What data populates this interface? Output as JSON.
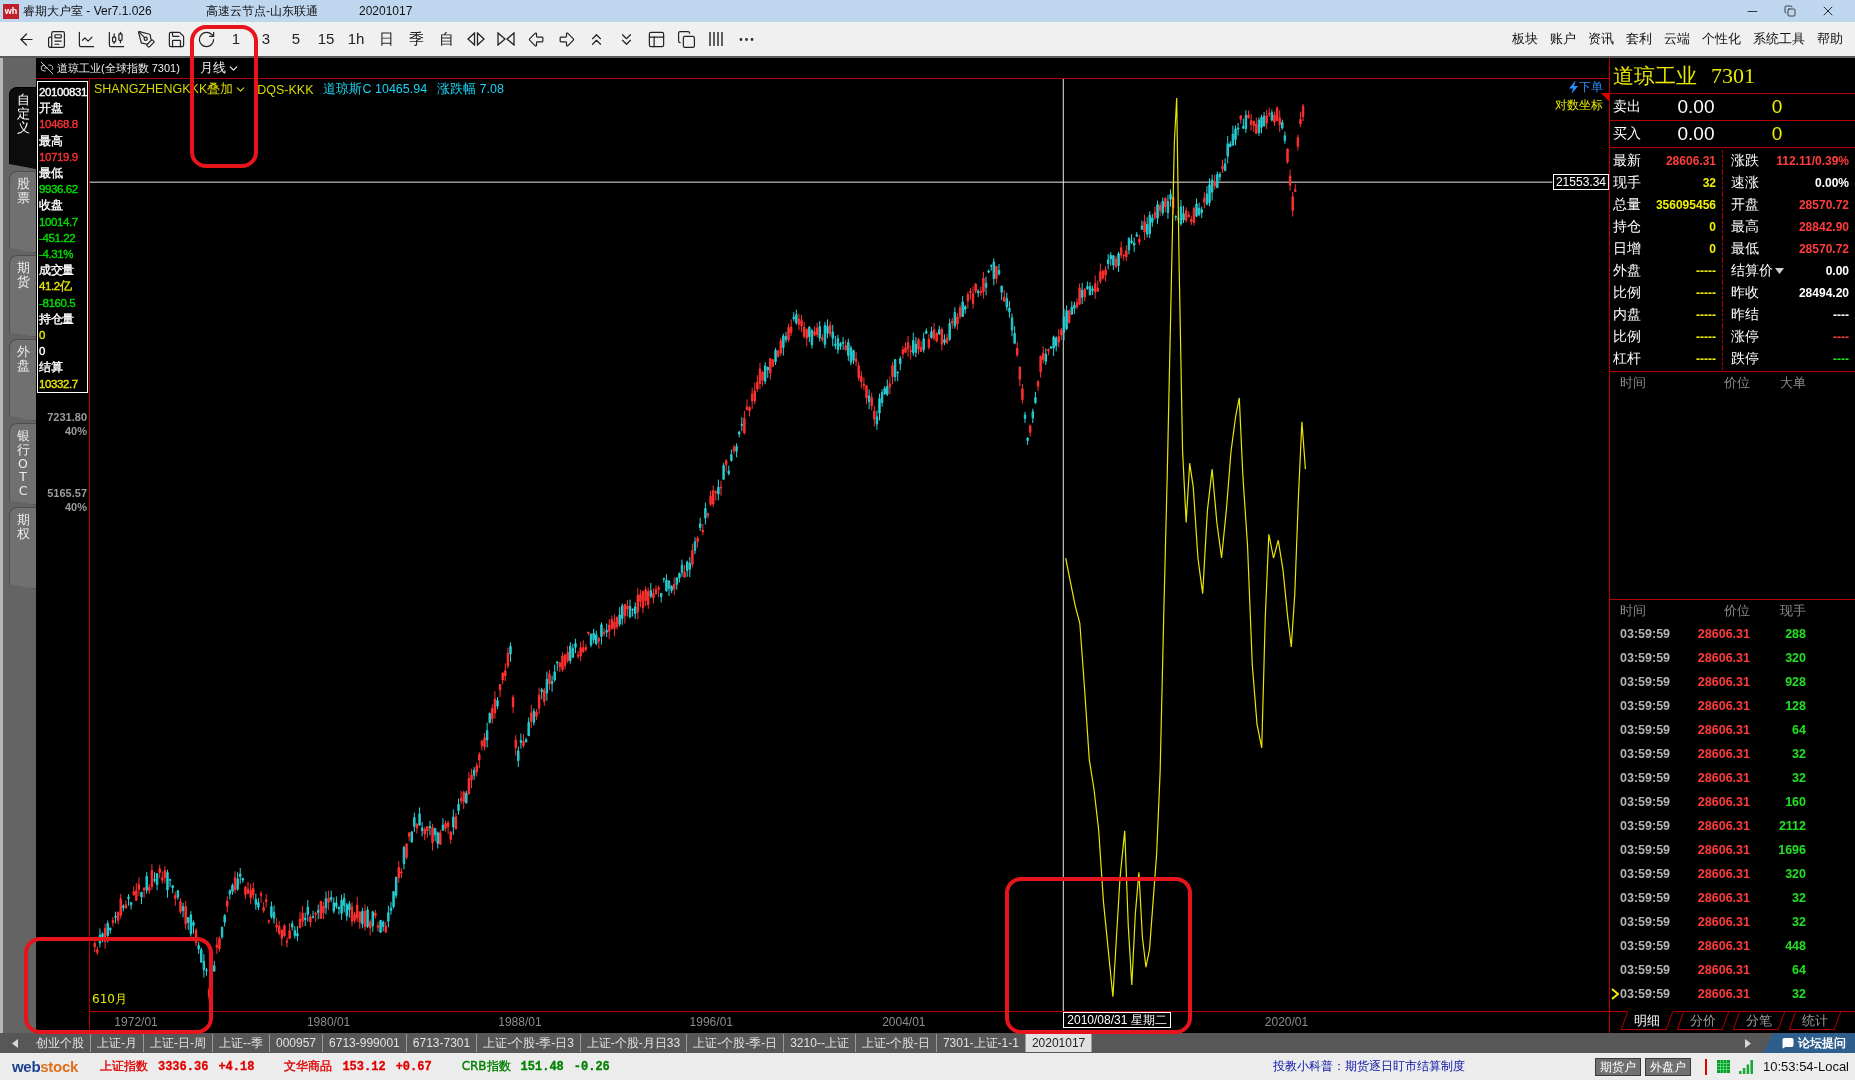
{
  "window": {
    "logo": "wh",
    "title": "睿期大户室 - Ver7.1.026",
    "server": "高速云节点-山东联通",
    "date": "20201017"
  },
  "toolbar": {
    "periods": [
      "1",
      "3",
      "5",
      "15",
      "1h",
      "日",
      "季",
      "自"
    ]
  },
  "menu": [
    "板块",
    "账户",
    "资讯",
    "套利",
    "云端",
    "个性化",
    "系统工具",
    "帮助"
  ],
  "side_tabs": [
    {
      "label": "自定义",
      "selected": true
    },
    {
      "label": "股票",
      "selected": false
    },
    {
      "label": "期货",
      "selected": false
    },
    {
      "label": "外盘",
      "selected": false
    },
    {
      "label": "银行OTC",
      "selected": false
    },
    {
      "label": "期权",
      "selected": false
    }
  ],
  "chart": {
    "title": "道琼工业(全球指数 7301)",
    "period": "月线",
    "overlay": "SHANGZHENGKKK叠加",
    "overlay_symbol": "DQS-KKK",
    "readouts": [
      "道琼斯C 10465.94",
      "涨跌幅 7.08"
    ],
    "order_link": "下单",
    "scale_mode": "对数坐标",
    "cursor_values": [
      {
        "text": "20100831",
        "color": "#ffffff"
      },
      {
        "text": "开盘",
        "color": "#ffffff"
      },
      {
        "text": "10468.8",
        "color": "#ff3232"
      },
      {
        "text": "最高",
        "color": "#ffffff"
      },
      {
        "text": "10719.9",
        "color": "#ff3232"
      },
      {
        "text": "最低",
        "color": "#ffffff"
      },
      {
        "text": "9936.62",
        "color": "#00e000"
      },
      {
        "text": "收盘",
        "color": "#ffffff"
      },
      {
        "text": "10014.7",
        "color": "#00e000"
      },
      {
        "text": "-451.22",
        "color": "#00e000"
      },
      {
        "text": "-4.31%",
        "color": "#00e000"
      },
      {
        "text": "成交量",
        "color": "#ffffff"
      },
      {
        "text": "41.2亿",
        "color": "#e8e800"
      },
      {
        "text": "-8160.5",
        "color": "#00e000"
      },
      {
        "text": "持仓量",
        "color": "#ffffff"
      },
      {
        "text": "0",
        "color": "#e8e800"
      },
      {
        "text": "0",
        "color": "#ffffff"
      },
      {
        "text": "结算",
        "color": "#ffffff"
      },
      {
        "text": "10332.7",
        "color": "#e8e800"
      }
    ],
    "axis_labels": [
      {
        "price": "7231.80",
        "percent": "40%"
      },
      {
        "price": "5165.57",
        "percent": "40%"
      }
    ],
    "period_marker": "610月",
    "x_labels": [
      "1972/01",
      "1980/01",
      "1988/01",
      "1996/01",
      "2004/01",
      "2020/01"
    ],
    "cursor_date": "2010/08/31 星期二",
    "cursor_price": "21553.34"
  },
  "quote_panel": {
    "name": "道琼工业",
    "code": "7301",
    "book": [
      {
        "label": "卖出",
        "price": "0.00",
        "volume": "0"
      },
      {
        "label": "买入",
        "price": "0.00",
        "volume": "0"
      }
    ],
    "rows": [
      {
        "left": {
          "kind": "field",
          "label": "最新",
          "value": "28606.31",
          "color": "#ff3c3c"
        },
        "right": {
          "kind": "field",
          "label": "涨跌",
          "value": "112.11/0.39%",
          "color": "#ff3c3c"
        }
      },
      {
        "left": {
          "kind": "field",
          "label": "现手",
          "value": "32",
          "color": "#f0f000"
        },
        "right": {
          "kind": "field",
          "label": "速涨",
          "value": "0.00%",
          "color": "#ffffff"
        }
      },
      {
        "left": {
          "kind": "field",
          "label": "总量",
          "value": "356095456",
          "color": "#f0f000"
        },
        "right": {
          "kind": "field",
          "label": "开盘",
          "value": "28570.72",
          "color": "#ff3c3c"
        }
      },
      {
        "left": {
          "kind": "field",
          "label": "持仓",
          "value": "0",
          "color": "#f0f000"
        },
        "right": {
          "kind": "field",
          "label": "最高",
          "value": "28842.90",
          "color": "#ff3c3c"
        }
      },
      {
        "left": {
          "kind": "field",
          "label": "日增",
          "value": "0",
          "color": "#f0f000"
        },
        "right": {
          "kind": "field",
          "label": "最低",
          "value": "28570.72",
          "color": "#ff3c3c"
        }
      },
      {
        "left": {
          "kind": "field",
          "label": "外盘",
          "value": "-----",
          "color": "#f0f000"
        },
        "right": {
          "kind": "dropdown",
          "label": "结算价",
          "value": "0.00",
          "color": "#ffffff"
        }
      },
      {
        "left": {
          "kind": "field",
          "label": "比例",
          "value": "-----",
          "color": "#f0f000"
        },
        "right": {
          "kind": "field",
          "label": "昨收",
          "value": "28494.20",
          "color": "#ffffff"
        }
      },
      {
        "left": {
          "kind": "field",
          "label": "内盘",
          "value": "-----",
          "color": "#f0f000"
        },
        "right": {
          "kind": "field",
          "label": "昨结",
          "value": "----",
          "color": "#ffffff"
        }
      },
      {
        "left": {
          "kind": "field",
          "label": "比例",
          "value": "-----",
          "color": "#f0f000"
        },
        "right": {
          "kind": "field",
          "label": "涨停",
          "value": "----",
          "color": "#ff3c3c"
        }
      },
      {
        "left": {
          "kind": "field",
          "label": "杠杆",
          "value": "-----",
          "color": "#f0f000"
        },
        "right": {
          "kind": "field",
          "label": "跌停",
          "value": "----",
          "color": "#22e022"
        }
      }
    ],
    "big_orders": {
      "columns": [
        "时间",
        "价位",
        "大单"
      ]
    },
    "ticks": {
      "columns": [
        "时间",
        "价位",
        "现手"
      ],
      "rows": [
        {
          "time": "03:59:59",
          "price": "28606.31",
          "volume": "288",
          "current": false
        },
        {
          "time": "03:59:59",
          "price": "28606.31",
          "volume": "320",
          "current": false
        },
        {
          "time": "03:59:59",
          "price": "28606.31",
          "volume": "928",
          "current": false
        },
        {
          "time": "03:59:59",
          "price": "28606.31",
          "volume": "128",
          "current": false
        },
        {
          "time": "03:59:59",
          "price": "28606.31",
          "volume": "64",
          "current": false
        },
        {
          "time": "03:59:59",
          "price": "28606.31",
          "volume": "32",
          "current": false
        },
        {
          "time": "03:59:59",
          "price": "28606.31",
          "volume": "32",
          "current": false
        },
        {
          "time": "03:59:59",
          "price": "28606.31",
          "volume": "160",
          "current": false
        },
        {
          "time": "03:59:59",
          "price": "28606.31",
          "volume": "2112",
          "current": false
        },
        {
          "time": "03:59:59",
          "price": "28606.31",
          "volume": "1696",
          "current": false
        },
        {
          "time": "03:59:59",
          "price": "28606.31",
          "volume": "320",
          "current": false
        },
        {
          "time": "03:59:59",
          "price": "28606.31",
          "volume": "32",
          "current": false
        },
        {
          "time": "03:59:59",
          "price": "28606.31",
          "volume": "32",
          "current": false
        },
        {
          "time": "03:59:59",
          "price": "28606.31",
          "volume": "448",
          "current": false
        },
        {
          "time": "03:59:59",
          "price": "28606.31",
          "volume": "64",
          "current": false
        },
        {
          "time": "03:59:59",
          "price": "28606.31",
          "volume": "32",
          "current": true
        }
      ]
    },
    "tabs": [
      {
        "label": "明细",
        "selected": true
      },
      {
        "label": "分价",
        "selected": false
      },
      {
        "label": "分笔",
        "selected": false
      },
      {
        "label": "统计",
        "selected": false
      }
    ]
  },
  "sheet_tabs": [
    {
      "label": "创业个股",
      "selected": false
    },
    {
      "label": "上证-月",
      "selected": false
    },
    {
      "label": "上证-日-周",
      "selected": false
    },
    {
      "label": "上证--季",
      "selected": false
    },
    {
      "label": "000957",
      "selected": false
    },
    {
      "label": "6713-999001",
      "selected": false
    },
    {
      "label": "6713-7301",
      "selected": false
    },
    {
      "label": "上证-个股-季-日3",
      "selected": false
    },
    {
      "label": "上证-个股-月日33",
      "selected": false
    },
    {
      "label": "上证-个股-季-日",
      "selected": false
    },
    {
      "label": "3210--上证",
      "selected": false
    },
    {
      "label": "上证-个股-日",
      "selected": false
    },
    {
      "label": "7301-上证-1-1",
      "selected": false
    },
    {
      "label": "20201017",
      "selected": true
    }
  ],
  "forum_button": "论坛提问",
  "status_bar": {
    "brand": {
      "first": "web",
      "second": "stock"
    },
    "indices": [
      {
        "name": "上证指数",
        "value": "3336.36",
        "change": "+4.18",
        "color": "#e00000"
      },
      {
        "name": "文华商品",
        "value": "153.12",
        "change": "+0.67",
        "color": "#e00000"
      },
      {
        "name": "CRB指数",
        "value": "151.48",
        "change": "-0.26",
        "color": "#008000"
      }
    ],
    "tip": "投教小科普：期货逐日盯市结算制度",
    "accounts": [
      "期货户",
      "外盘户"
    ],
    "clock": "10:53:54-Local"
  }
}
